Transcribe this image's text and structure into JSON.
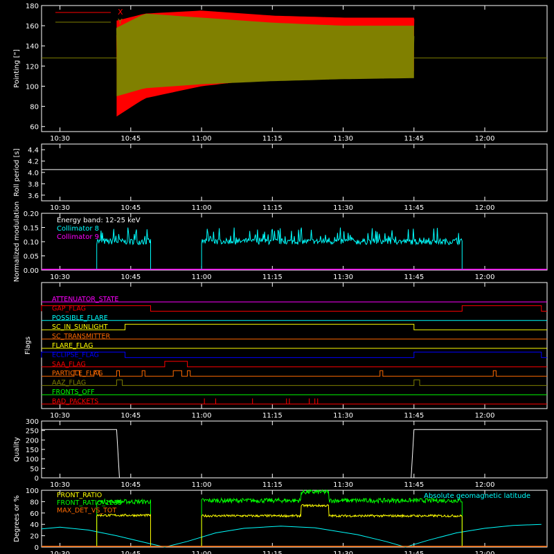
{
  "time_ticks": [
    "10:30",
    "10:45",
    "11:00",
    "11:15",
    "11:30",
    "11:45",
    "12:00"
  ],
  "colors": {
    "background": "#000000",
    "axes": "#ffffff",
    "x_red": "#ff0000",
    "y_olive": "#808000",
    "cyan": "#00ffff",
    "magenta": "#ff00ff",
    "yellow": "#ffff00",
    "green": "#00ff00",
    "orange": "#ff6a00",
    "blue": "#0000ff"
  },
  "chart_data": [
    {
      "id": "pointing",
      "type": "line",
      "ylabel": "Pointing [\"]",
      "ylim": [
        55,
        180
      ],
      "yticks": [
        60,
        80,
        100,
        120,
        140,
        160,
        180
      ],
      "legend": [
        "X",
        "Y"
      ],
      "reference_line": 128,
      "series": [
        {
          "name": "X",
          "color": "#ff0000",
          "envelope": [
            [
              10.7,
              70,
              165
            ],
            [
              10.8,
              88,
              172
            ],
            [
              11.0,
              100,
              175
            ],
            [
              11.25,
              108,
              170
            ],
            [
              11.5,
              112,
              168
            ],
            [
              11.75,
              115,
              168
            ]
          ]
        },
        {
          "name": "Y",
          "color": "#808000",
          "envelope": [
            [
              10.7,
              90,
              158
            ],
            [
              10.8,
              98,
              172
            ],
            [
              11.0,
              102,
              168
            ],
            [
              11.25,
              105,
              163
            ],
            [
              11.5,
              107,
              160
            ],
            [
              11.75,
              108,
              160
            ]
          ]
        }
      ],
      "time_range": [
        10.7,
        11.75
      ]
    },
    {
      "id": "roll",
      "type": "line",
      "ylabel": "Roll period [s]",
      "ylim": [
        3.5,
        4.5
      ],
      "yticks": [
        "3.6",
        "3.8",
        "4.0",
        "4.2",
        "4.4"
      ],
      "series": [
        {
          "name": "",
          "color": "#ffffff",
          "constant": 4.05
        }
      ]
    },
    {
      "id": "modulation",
      "type": "line",
      "ylabel": "Normalized modulation",
      "ylim": [
        0,
        0.2
      ],
      "yticks": [
        "0.00",
        "0.05",
        "0.10",
        "0.15",
        "0.20"
      ],
      "legend_title": "Energy band: 12-25 keV",
      "series": [
        {
          "name": "Collimator 8",
          "color": "#00ffff",
          "segments": [
            [
              10.63,
              10.82,
              0.1
            ],
            [
              11.0,
              11.92,
              0.1
            ]
          ],
          "noise": 0.06
        },
        {
          "name": "Collimator 9",
          "color": "#ff00ff",
          "constant": 0
        }
      ]
    },
    {
      "id": "flags",
      "type": "step",
      "ylabel": "Flags",
      "flags": [
        {
          "name": "ATTENUATOR_STATE",
          "color": "#ff00ff",
          "high": []
        },
        {
          "name": "GAP_FLAG",
          "color": "#ff0000",
          "high": [
            [
              10.42,
              10.82
            ],
            [
              11.92,
              12.2
            ]
          ]
        },
        {
          "name": "POSSIBLE_FLARE",
          "color": "#00ffff",
          "high": []
        },
        {
          "name": "SC_IN_SUNLIGHT",
          "color": "#ffff00",
          "high": [
            [
              10.73,
              11.75
            ]
          ]
        },
        {
          "name": "SC_TRANSMITTER",
          "color": "#ff6a00",
          "high": []
        },
        {
          "name": "FLARE_FLAG",
          "color": "#ffff00",
          "high": []
        },
        {
          "name": "ECLIPSE_FLAG",
          "color": "#0000ff",
          "high": [
            [
              10.42,
              10.73
            ],
            [
              11.75,
              12.2
            ]
          ]
        },
        {
          "name": "SAA_FLAG",
          "color": "#ff0000",
          "high": [
            [
              10.87,
              10.95
            ]
          ]
        },
        {
          "name": "PARTICLE_FLAG",
          "color": "#ff6a00",
          "high": [
            [
              10.55,
              10.57
            ],
            [
              10.62,
              10.64
            ],
            [
              10.7,
              10.71
            ],
            [
              10.79,
              10.8
            ],
            [
              10.9,
              10.93
            ],
            [
              10.95,
              10.96
            ],
            [
              11.63,
              11.64
            ],
            [
              12.03,
              12.04
            ]
          ]
        },
        {
          "name": "AAZ_FLAG",
          "color": "#808000",
          "high": [
            [
              10.7,
              10.72
            ],
            [
              11.75,
              11.77
            ]
          ]
        },
        {
          "name": "FRONTS_OFF",
          "color": "#00ff00",
          "high": []
        },
        {
          "name": "BAD_PACKETS",
          "color": "#ff0000",
          "spikes": [
            11.01,
            11.05,
            11.18,
            11.3,
            11.31,
            11.38,
            11.4,
            11.41
          ]
        }
      ]
    },
    {
      "id": "quality",
      "type": "line",
      "ylabel": "Quality",
      "ylim": [
        0,
        300
      ],
      "yticks": [
        "0",
        "50",
        "100",
        "150",
        "200",
        "250",
        "300"
      ],
      "series": [
        {
          "name": "",
          "color": "#ffffff",
          "points": [
            [
              10.42,
              255
            ],
            [
              10.7,
              255
            ],
            [
              10.71,
              0
            ],
            [
              11.74,
              0
            ],
            [
              11.75,
              255
            ],
            [
              12.2,
              255
            ]
          ]
        }
      ]
    },
    {
      "id": "ratios",
      "type": "line",
      "ylabel": "Degrees or %",
      "ylim": [
        0,
        100
      ],
      "yticks": [
        "0",
        "20",
        "40",
        "60",
        "80",
        "100"
      ],
      "legend": [
        "FRONT_RATIO",
        "FRONT_RATIO_1235",
        "MAX_DET_VS_TOT"
      ],
      "right_label": "Absolute geomagnetic latitude",
      "series": [
        {
          "name": "FRONT_RATIO",
          "color": "#ffff00",
          "segments": [
            [
              10.63,
              10.82,
              56
            ],
            [
              11.0,
              11.92,
              55
            ]
          ]
        },
        {
          "name": "FRONT_RATIO_1235",
          "color": "#00ff00",
          "segments": [
            [
              10.63,
              10.82,
              80
            ],
            [
              11.0,
              11.92,
              82
            ]
          ]
        },
        {
          "name": "MAX_DET_VS_TOT",
          "color": "#ff6a00",
          "constant": 0
        },
        {
          "name": "Absolute geomagnetic latitude",
          "color": "#00ffff",
          "points": [
            [
              10.42,
              32
            ],
            [
              10.5,
              35
            ],
            [
              10.6,
              30
            ],
            [
              10.7,
              20
            ],
            [
              10.8,
              8
            ],
            [
              10.87,
              0
            ],
            [
              10.95,
              10
            ],
            [
              11.05,
              25
            ],
            [
              11.15,
              33
            ],
            [
              11.28,
              37
            ],
            [
              11.4,
              34
            ],
            [
              11.55,
              22
            ],
            [
              11.65,
              10
            ],
            [
              11.72,
              0
            ],
            [
              11.8,
              12
            ],
            [
              11.9,
              25
            ],
            [
              12.0,
              33
            ],
            [
              12.1,
              38
            ],
            [
              12.2,
              40
            ]
          ]
        }
      ]
    }
  ]
}
